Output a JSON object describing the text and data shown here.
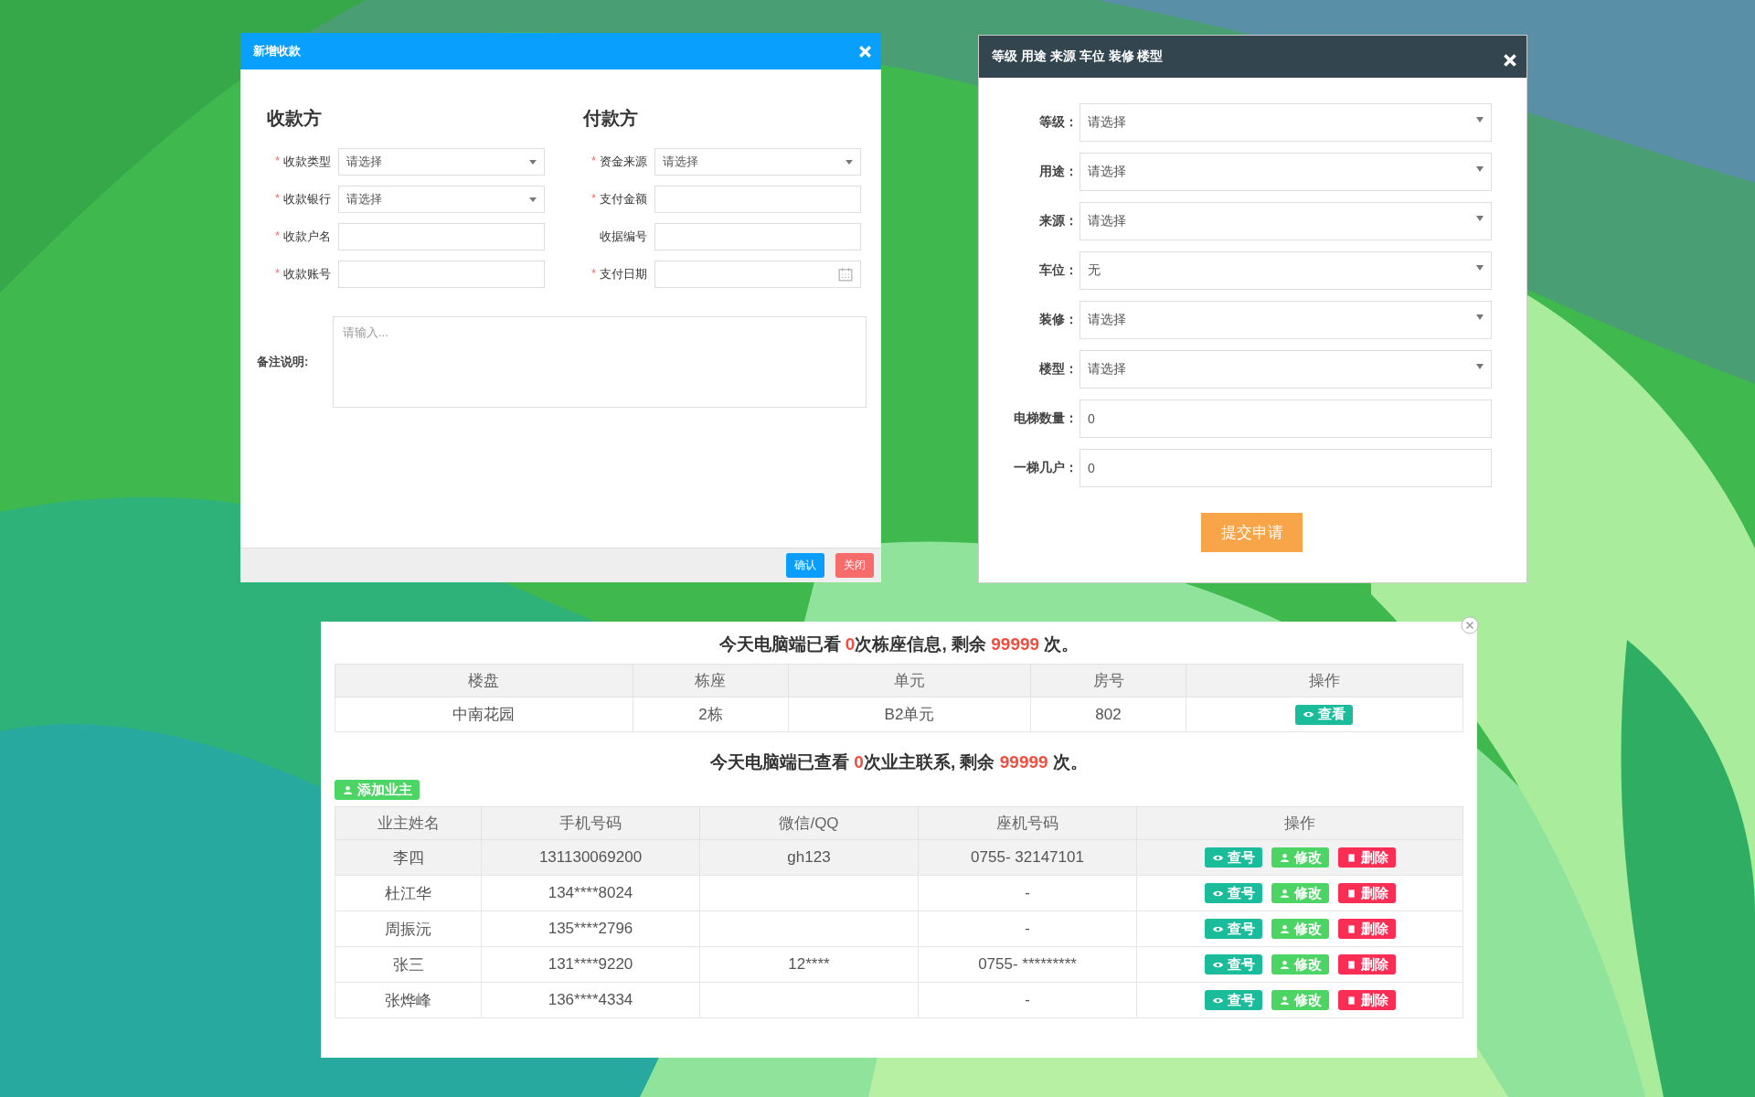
{
  "payment_dialog": {
    "title": "新增收款",
    "sections": [
      {
        "heading": "收款方",
        "fields": [
          {
            "label": "收款类型",
            "required_mark": "*",
            "kind": "select",
            "value": "请选择"
          },
          {
            "label": "收款银行",
            "required_mark": "*",
            "kind": "select",
            "value": "请选择"
          },
          {
            "label": "收款户名",
            "required_mark": "*",
            "kind": "text"
          },
          {
            "label": "收款账号",
            "required_mark": "*",
            "kind": "text"
          }
        ]
      },
      {
        "heading": "付款方",
        "fields": [
          {
            "label": "资金来源",
            "required_mark": "*",
            "kind": "select",
            "value": "请选择"
          },
          {
            "label": "支付金额",
            "required_mark": "*",
            "kind": "text"
          },
          {
            "label": "收据编号",
            "kind": "text"
          },
          {
            "label": "支付日期",
            "required_mark": "*",
            "kind": "date"
          }
        ]
      }
    ],
    "remarks": {
      "label": "备注说明:",
      "placeholder": "请输入..."
    },
    "buttons": [
      {
        "label": "确认",
        "kind": "primary"
      },
      {
        "label": "关闭",
        "kind": "danger"
      }
    ]
  },
  "attributes_dialog": {
    "title": "等级 用途 来源 车位 装修 楼型",
    "fields": [
      {
        "label": "等级：",
        "kind": "select",
        "value": "请选择"
      },
      {
        "label": "用途：",
        "kind": "select",
        "value": "请选择"
      },
      {
        "label": "来源：",
        "kind": "select",
        "value": "请选择"
      },
      {
        "label": "车位：",
        "kind": "select",
        "value": "无"
      },
      {
        "label": "装修：",
        "kind": "select",
        "value": "请选择"
      },
      {
        "label": "楼型：",
        "kind": "select",
        "value": "请选择"
      },
      {
        "label": "电梯数量：",
        "kind": "text",
        "value": "0"
      },
      {
        "label": "一梯几户：",
        "kind": "text",
        "value": "0"
      }
    ],
    "submit_button": "提交申请"
  },
  "owner_dialog": {
    "building_notice": [
      {
        "text": "今天电脑端已看 ",
        "highlight": false
      },
      {
        "text": "0",
        "highlight": true
      },
      {
        "text": "次栋座信息, 剩余 ",
        "highlight": false
      },
      {
        "text": "99999",
        "highlight": true
      },
      {
        "text": " 次。",
        "highlight": false
      }
    ],
    "building_table": {
      "columns": [
        "楼盘",
        "栋座",
        "单元",
        "房号",
        "操作"
      ],
      "rows": [
        {
          "estate": "中南花园",
          "building": "2栋",
          "unit": "B2单元",
          "room": "802",
          "action": "查看"
        }
      ]
    },
    "owner_notice": [
      {
        "text": "今天电脑端已查看 ",
        "highlight": false
      },
      {
        "text": "0",
        "highlight": true
      },
      {
        "text": "次业主联系, 剩余 ",
        "highlight": false
      },
      {
        "text": "99999",
        "highlight": true
      },
      {
        "text": " 次。",
        "highlight": false
      }
    ],
    "add_owner_button": "添加业主",
    "owner_table": {
      "columns": [
        "业主姓名",
        "手机号码",
        "微信/QQ",
        "座机号码",
        "操作"
      ],
      "rows": [
        {
          "selected": true,
          "name": "李四",
          "mobile": "131130069200",
          "wechat_qq": "gh123",
          "landline": "0755- 32147101",
          "actions": [
            {
              "label": "查号",
              "kind": "view"
            },
            {
              "label": "修改",
              "kind": "edit"
            },
            {
              "label": "删除",
              "kind": "delete"
            }
          ]
        },
        {
          "selected": false,
          "name": "杜江华",
          "mobile": "134****8024",
          "landline": "-",
          "actions": [
            {
              "label": "查号",
              "kind": "view"
            },
            {
              "label": "修改",
              "kind": "edit"
            },
            {
              "label": "删除",
              "kind": "delete"
            }
          ]
        },
        {
          "selected": false,
          "name": "周振沅",
          "mobile": "135****2796",
          "landline": "-",
          "actions": [
            {
              "label": "查号",
              "kind": "view"
            },
            {
              "label": "修改",
              "kind": "edit"
            },
            {
              "label": "删除",
              "kind": "delete"
            }
          ]
        },
        {
          "selected": false,
          "name": "张三",
          "mobile": "131****9220",
          "wechat_qq": "12****",
          "landline": "0755- *********",
          "actions": [
            {
              "label": "查号",
              "kind": "view"
            },
            {
              "label": "修改",
              "kind": "edit"
            },
            {
              "label": "删除",
              "kind": "delete"
            }
          ]
        },
        {
          "selected": false,
          "name": "张烨峰",
          "mobile": "136****4334",
          "landline": "-",
          "actions": [
            {
              "label": "查号",
              "kind": "view"
            },
            {
              "label": "修改",
              "kind": "edit"
            },
            {
              "label": "删除",
              "kind": "delete"
            }
          ]
        }
      ]
    }
  }
}
